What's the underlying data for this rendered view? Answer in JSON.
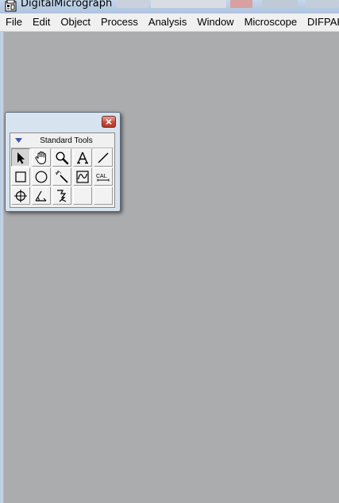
{
  "window": {
    "title": "DigitalMicrograph"
  },
  "menu": {
    "items": [
      {
        "label": "File"
      },
      {
        "label": "Edit"
      },
      {
        "label": "Object"
      },
      {
        "label": "Process"
      },
      {
        "label": "Analysis"
      },
      {
        "label": "Window"
      },
      {
        "label": "Microscope"
      },
      {
        "label": "DIFPAK"
      }
    ]
  },
  "palette": {
    "header": "Standard Tools",
    "tools": [
      {
        "icon": "arrow-pointer-icon",
        "selected": true
      },
      {
        "icon": "hand-pan-icon",
        "selected": false
      },
      {
        "icon": "magnifier-icon",
        "selected": false
      },
      {
        "icon": "text-tool-icon",
        "selected": false
      },
      {
        "icon": "line-tool-icon",
        "selected": false
      },
      {
        "icon": "rectangle-tool-icon",
        "selected": false
      },
      {
        "icon": "oval-tool-icon",
        "selected": false
      },
      {
        "icon": "magic-wand-icon",
        "selected": false
      },
      {
        "icon": "profile-tool-icon",
        "selected": false
      },
      {
        "icon": "calibration-tool-icon",
        "selected": false,
        "text": "CAL"
      },
      {
        "icon": "crosshair-tool-icon",
        "selected": false
      },
      {
        "icon": "angle-tool-icon",
        "selected": false
      },
      {
        "icon": "lasso-tool-icon",
        "selected": false
      },
      {
        "icon": "empty-slot",
        "selected": false
      },
      {
        "icon": "empty-slot",
        "selected": false
      }
    ]
  },
  "colors": {
    "workspace": "#abacad",
    "menubar": "#f0f0f0",
    "palette_frame": "#d7e3ef",
    "close_button": "#c64b3a"
  }
}
